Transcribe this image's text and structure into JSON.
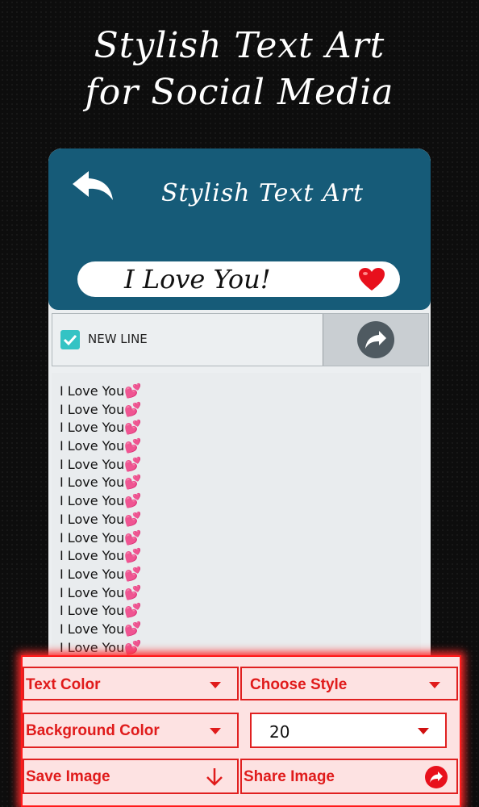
{
  "promo": {
    "line1": "Stylish Text  Art",
    "line2": "for Social Media"
  },
  "app": {
    "title": "Stylish Text Art",
    "back_icon": "back-arrow-icon",
    "input_text": "I Love You!",
    "input_icon": "heart-emoji-icon"
  },
  "options": {
    "newline_label": "NEW LINE",
    "newline_checked": true,
    "share_icon": "share-arrow-icon"
  },
  "output": {
    "lines": [
      "I Love You",
      "I Love You",
      "I Love You",
      "I Love You",
      "I Love You",
      "I Love You",
      "I Love You",
      "I Love You",
      "I Love You",
      "I Love You",
      "I Love You",
      "I Love You",
      "I Love You",
      "I Love You",
      "I Love You"
    ],
    "suffix": "💕"
  },
  "controls": {
    "text_color": "Text Color",
    "choose_style": "Choose Style",
    "background_color": "Background Color",
    "size_value": "20",
    "save_image": "Save Image",
    "share_image": "Share Image"
  },
  "colors": {
    "header": "#165b78",
    "accent_red": "#e01b1b",
    "checkbox": "#34c3c4"
  }
}
